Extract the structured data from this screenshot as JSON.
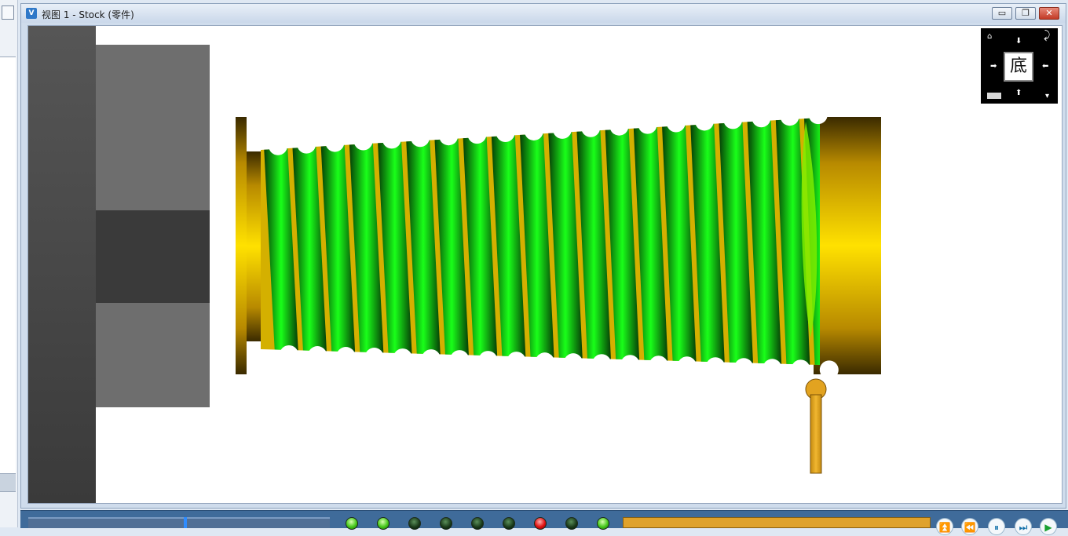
{
  "window": {
    "title": "视图 1 - Stock (零件)",
    "app_icon_text": "V",
    "minimize_glyph": "▭",
    "restore_glyph": "❐",
    "close_glyph": "✕"
  },
  "navcube": {
    "face_label": "底",
    "arrows": {
      "up": "⬇",
      "down": "⬆",
      "left": "➡",
      "right": "⬅",
      "rotate": "⤸",
      "home": "⌂",
      "menu": "▾"
    }
  },
  "scene": {
    "colors": {
      "chuck_dark": "#4c4c4c",
      "chuck_light": "#6f6f6f",
      "thread_green": "#14d014",
      "stock_gold": "#f4cf00",
      "tool_gold": "#e2a320"
    }
  },
  "statusbar": {
    "progress": 0.52,
    "leds": [
      "green",
      "green",
      "dark",
      "dark",
      "dark",
      "dark",
      "red",
      "dark",
      "green"
    ],
    "controls": [
      "⏫",
      "⏪",
      "⏸",
      "⏭",
      "▶"
    ]
  }
}
